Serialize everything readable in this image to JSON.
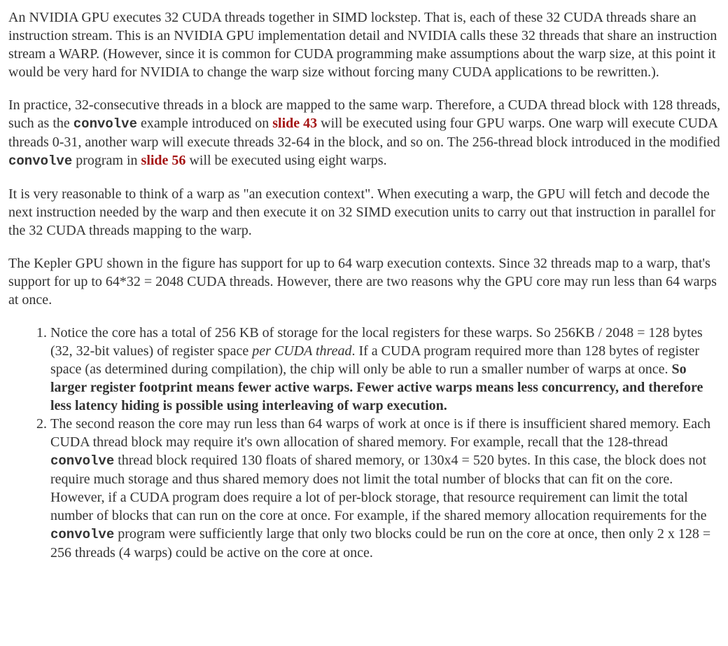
{
  "p1": {
    "text": "An NVIDIA GPU executes 32 CUDA threads together in SIMD lockstep. That is, each of these 32 CUDA threads share an instruction stream. This is an NVIDIA GPU implementation detail and NVIDIA calls these 32 threads that share an instruction stream a WARP. (However, since it is common for CUDA programming make assumptions about the warp size, at this point it would be very hard for NVIDIA to change the warp size without forcing many CUDA applications to be rewritten.)."
  },
  "p2": {
    "a": "In practice, 32-consecutive threads in a block are mapped to the same warp. Therefore, a CUDA thread block with 128 threads, such as the ",
    "code1": "convolve",
    "b": " example introduced on ",
    "link1": "slide 43",
    "c": " will be executed using four GPU warps. One warp will execute CUDA threads 0-31, another warp will execute threads 32-64 in the block, and so on. The 256-thread block introduced in the modified ",
    "code2": "convolve",
    "d": " program in ",
    "link2": "slide 56",
    "e": " will be executed using eight warps."
  },
  "p3": {
    "text": "It is very reasonable to think of a warp as \"an execution context\". When executing a warp, the GPU will fetch and decode the next instruction needed by the warp and then execute it on 32 SIMD execution units to carry out that instruction in parallel for the 32 CUDA threads mapping to the warp."
  },
  "p4": {
    "text": "The Kepler GPU shown in the figure has support for up to 64 warp execution contexts. Since 32 threads map to a warp, that's support for up to 64*32 = 2048 CUDA threads. However, there are two reasons why the GPU core may run less than 64 warps at once."
  },
  "list": {
    "item1": {
      "a": "Notice the core has a total of 256 KB of storage for the local registers for these warps. So 256KB / 2048 = 128 bytes (32, 32-bit values) of register space ",
      "italic": "per CUDA thread",
      "b": ". If a CUDA program required more than 128 bytes of register space (as determined during compilation), the chip will only be able to run a smaller number of warps at once. ",
      "bold": "So larger register footprint means fewer active warps. Fewer active warps means less concurrency, and therefore less latency hiding is possible using interleaving of warp execution."
    },
    "item2": {
      "a": "The second reason the core may run less than 64 warps of work at once is if there is insufficient shared memory. Each CUDA thread block may require it's own allocation of shared memory. For example, recall that the 128-thread ",
      "code1": "convolve",
      "b": " thread block required 130 floats of shared memory, or 130x4 = 520 bytes. In this case, the block does not require much storage and thus shared memory does not limit the total number of blocks that can fit on the core. However, if a CUDA program does require a lot of per-block storage, that resource requirement can limit the total number of blocks that can run on the core at once. For example, if the shared memory allocation requirements for the ",
      "code2": "convolve",
      "c": " program were sufficiently large that only two blocks could be run on the core at once, then only 2 x 128 = 256 threads (4 warps) could be active on the core at once."
    }
  }
}
